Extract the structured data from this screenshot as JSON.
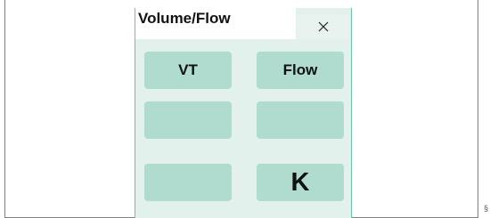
{
  "dialog": {
    "title": "Volume/Flow",
    "close_icon": "close-icon"
  },
  "keys": [
    {
      "label": "VT"
    },
    {
      "label": "Flow"
    },
    {
      "label": ""
    },
    {
      "label": ""
    },
    {
      "label": ""
    },
    {
      "label": "K"
    }
  ],
  "corner_mark": "§",
  "colors": {
    "panel_bg": "#e3f1ed",
    "key_bg": "#afdcce",
    "panel_border": "#6cc3ac"
  }
}
